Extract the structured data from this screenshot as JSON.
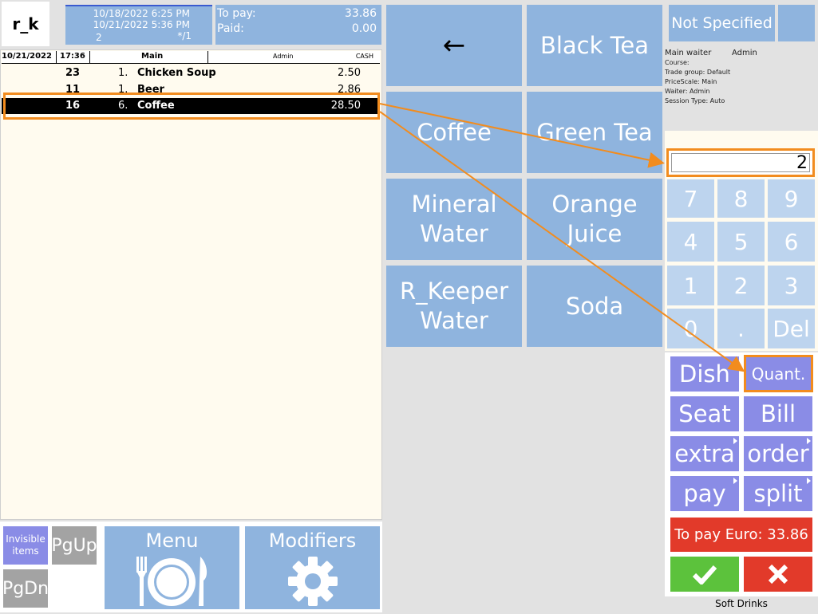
{
  "app": {
    "logo": "r_k"
  },
  "header": {
    "open_time": "10/18/2022 6:25 PM",
    "current_time": "10/21/2022 5:36 PM",
    "guests": "2",
    "table_marker": "*/1",
    "to_pay_label": "To pay:",
    "to_pay_value": "33.86",
    "paid_label": "Paid:",
    "paid_value": "0.00"
  },
  "order_header": {
    "date": "10/21/2022",
    "time": "17:36",
    "hall": "Main",
    "waiter": "Admin",
    "currency": "CASH"
  },
  "order_items": [
    {
      "code": "23",
      "qty": "1.",
      "name": "Chicken Soup",
      "price": "2.50"
    },
    {
      "code": "11",
      "qty": "1.",
      "name": "Beer",
      "price": "2.86"
    },
    {
      "code": "16",
      "qty": "6.",
      "name": "Coffee",
      "price": "28.50"
    }
  ],
  "left_bottom": {
    "invisible_items": "Invisible items",
    "pgup": "PgUp",
    "pgdn": "PgDn",
    "menu": "Menu",
    "modifiers": "Modifiers"
  },
  "menu_grid": {
    "back_arrow": "←",
    "items": [
      "Black Tea",
      "Coffee",
      "Green Tea",
      "Mineral Water",
      "Orange Juice",
      "R_Keeper Water",
      "Soda"
    ]
  },
  "info_panel": {
    "guest_type": "Not Specified",
    "main_waiter_label": "Main waiter",
    "main_waiter_value": "Admin",
    "course": "Course:",
    "trade_group": "Trade group: Default",
    "price_scale": "PriceScale: Main",
    "waiter": "Waiter: Admin",
    "session_type": "Session Type: Auto"
  },
  "keypad": {
    "display_value": "2",
    "keys": [
      "7",
      "8",
      "9",
      "4",
      "5",
      "6",
      "1",
      "2",
      "3",
      "0",
      ".",
      "Del"
    ]
  },
  "actions": {
    "dish": "Dish",
    "quant": "Quant.",
    "seat": "Seat",
    "bill": "Bill",
    "extra": "extra",
    "order": "order",
    "pay": "pay",
    "split": "split",
    "to_pay_button": "To pay Euro: 33.86"
  },
  "footer": {
    "category": "Soft Drinks"
  },
  "colors": {
    "tile": "#8fb4de",
    "keypad": "#bdd4ee",
    "action": "#8a8ce6",
    "highlight": "#f28c1e",
    "pay_red": "#e23a2a",
    "confirm_green": "#5cc23c",
    "panel_bg": "#fffbef"
  }
}
